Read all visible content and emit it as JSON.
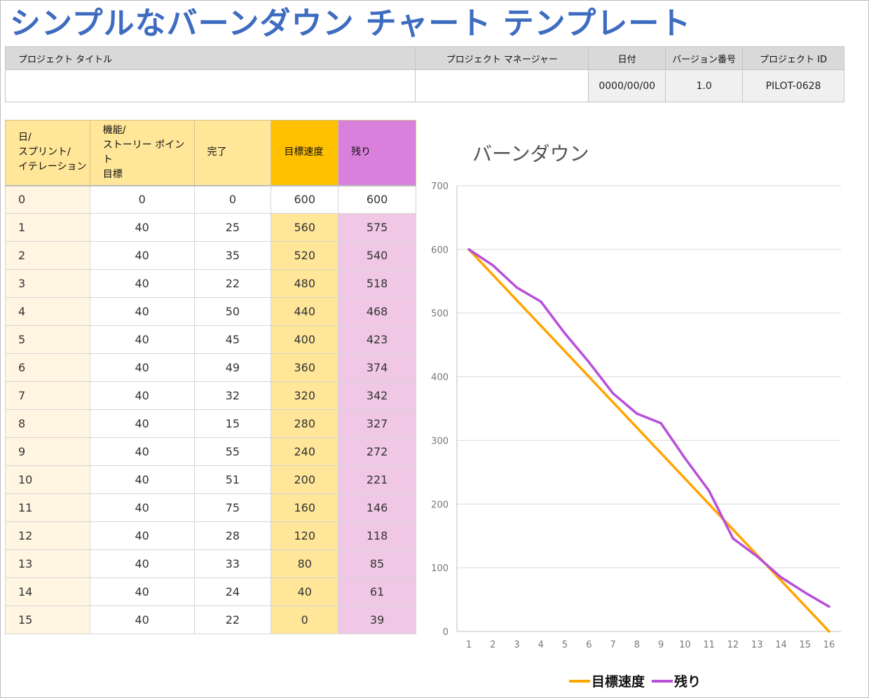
{
  "title": "シンプルなバーンダウン チャート テンプレート",
  "info": {
    "headers": [
      "プロジェクト タイトル",
      "プロジェクト マネージャー",
      "日付",
      "バージョン番号",
      "プロジェクト ID"
    ],
    "project_title": "",
    "project_manager": "",
    "date": "0000/00/00",
    "version": "1.0",
    "project_id": "PILOT-0628"
  },
  "table": {
    "headers": {
      "day": [
        "日/",
        "スプリント/",
        "イテレーション"
      ],
      "goal": [
        "機能/",
        "ストーリー ポイント",
        "目標"
      ],
      "done": "完了",
      "target": "目標速度",
      "remaining": "残り"
    },
    "rows": [
      {
        "day": "0",
        "goal": "0",
        "done": "0",
        "target": "600",
        "remaining": "600"
      },
      {
        "day": "1",
        "goal": "40",
        "done": "25",
        "target": "560",
        "remaining": "575"
      },
      {
        "day": "2",
        "goal": "40",
        "done": "35",
        "target": "520",
        "remaining": "540"
      },
      {
        "day": "3",
        "goal": "40",
        "done": "22",
        "target": "480",
        "remaining": "518"
      },
      {
        "day": "4",
        "goal": "40",
        "done": "50",
        "target": "440",
        "remaining": "468"
      },
      {
        "day": "5",
        "goal": "40",
        "done": "45",
        "target": "400",
        "remaining": "423"
      },
      {
        "day": "6",
        "goal": "40",
        "done": "49",
        "target": "360",
        "remaining": "374"
      },
      {
        "day": "7",
        "goal": "40",
        "done": "32",
        "target": "320",
        "remaining": "342"
      },
      {
        "day": "8",
        "goal": "40",
        "done": "15",
        "target": "280",
        "remaining": "327"
      },
      {
        "day": "9",
        "goal": "40",
        "done": "55",
        "target": "240",
        "remaining": "272"
      },
      {
        "day": "10",
        "goal": "40",
        "done": "51",
        "target": "200",
        "remaining": "221"
      },
      {
        "day": "11",
        "goal": "40",
        "done": "75",
        "target": "160",
        "remaining": "146"
      },
      {
        "day": "12",
        "goal": "40",
        "done": "28",
        "target": "120",
        "remaining": "118"
      },
      {
        "day": "13",
        "goal": "40",
        "done": "33",
        "target": "80",
        "remaining": "85"
      },
      {
        "day": "14",
        "goal": "40",
        "done": "24",
        "target": "40",
        "remaining": "61"
      },
      {
        "day": "15",
        "goal": "40",
        "done": "22",
        "target": "0",
        "remaining": "39"
      }
    ]
  },
  "chart_data": {
    "type": "line",
    "title": "バーンダウン",
    "xlabel": "",
    "ylabel": "",
    "categories": [
      "1",
      "2",
      "3",
      "4",
      "5",
      "6",
      "7",
      "8",
      "9",
      "10",
      "11",
      "12",
      "13",
      "14",
      "15",
      "16"
    ],
    "ylim": [
      0,
      700
    ],
    "yticks": [
      0,
      100,
      200,
      300,
      400,
      500,
      600,
      700
    ],
    "grid": true,
    "legend": "bottom",
    "series": [
      {
        "name": "目標速度",
        "color": "#ffa500",
        "values": [
          600,
          560,
          520,
          480,
          440,
          400,
          360,
          320,
          280,
          240,
          200,
          160,
          120,
          80,
          40,
          0
        ]
      },
      {
        "name": "残り",
        "color": "#b84fd8",
        "values": [
          600,
          575,
          540,
          518,
          468,
          423,
          374,
          342,
          327,
          272,
          221,
          146,
          118,
          85,
          61,
          39
        ]
      }
    ]
  },
  "colors": {
    "title": "#3d6cc0",
    "target": "#ffc000",
    "remaining": "#d97fdc"
  }
}
